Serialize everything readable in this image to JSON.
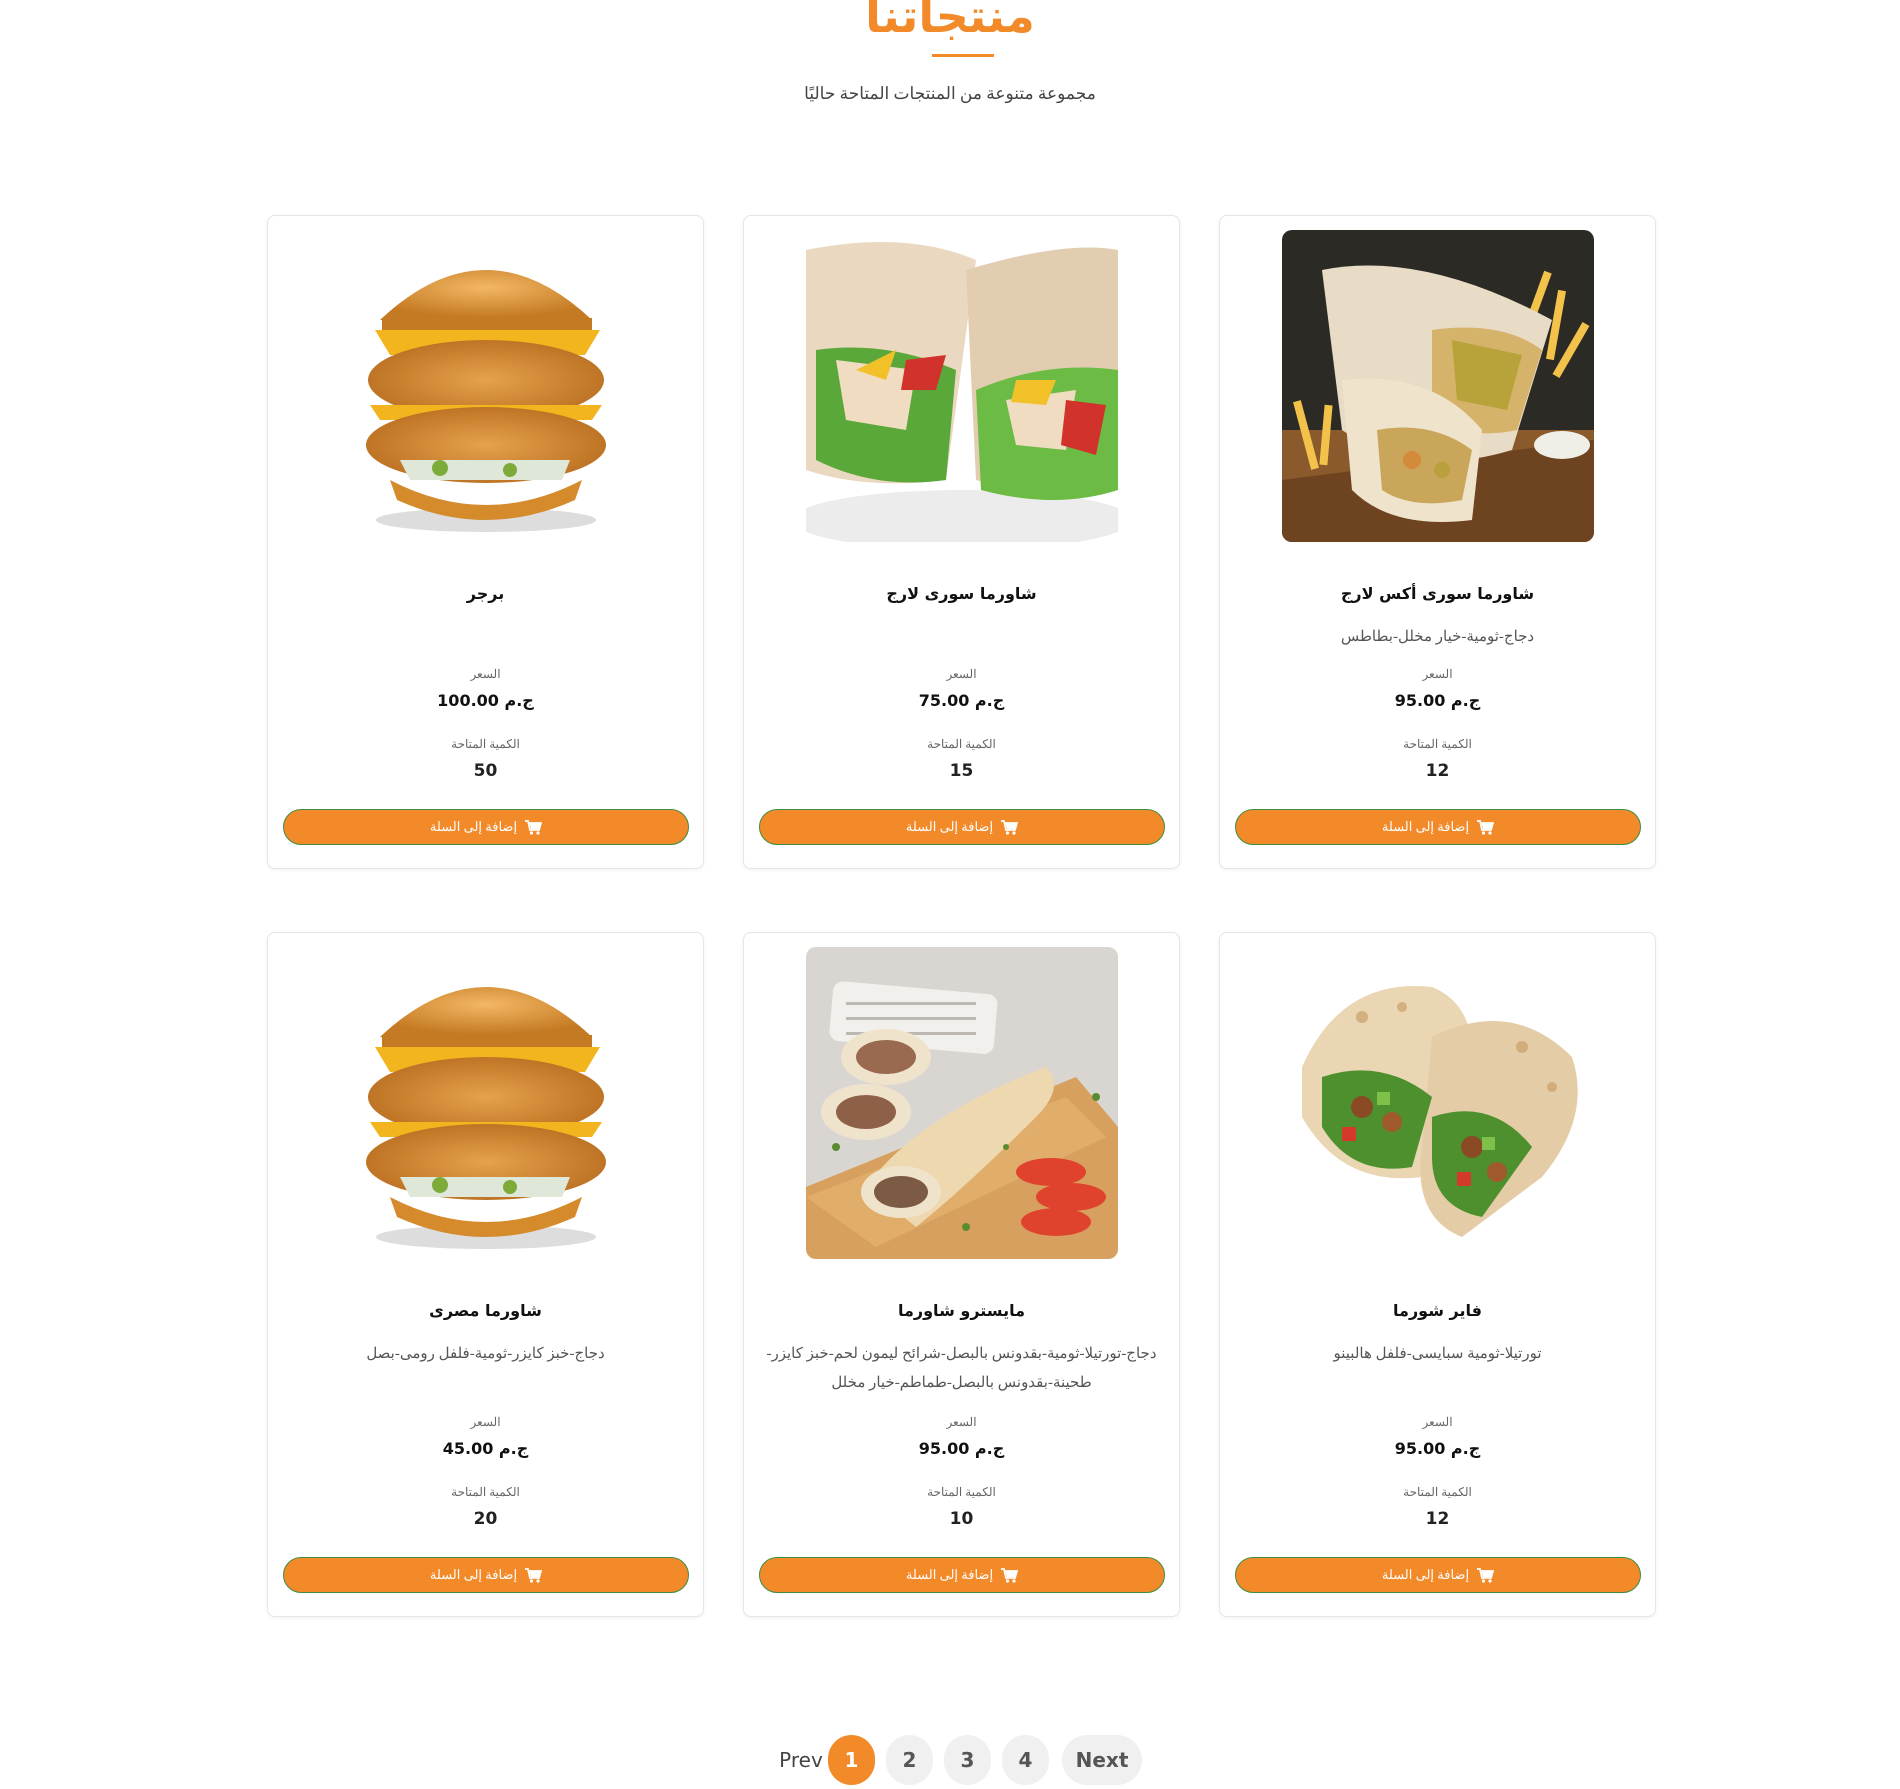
{
  "header": {
    "title": "منتجاتنا",
    "subtitle": "مجموعة متنوعة من المنتجات المتاحة حاليًا"
  },
  "labels": {
    "price": "السعر",
    "quantity": "الكمية المتاحة",
    "add_to_cart": "إضافة إلى السلة"
  },
  "products": [
    {
      "name": "شاورما سورى أكس لارج",
      "description": "دجاج-ثومية-خيار مخلل-بطاطس",
      "price": "ج.م 95.00",
      "quantity": "12",
      "image_icon": "shawarma-fries-photo"
    },
    {
      "name": "شاورما سورى لارج",
      "description": "",
      "price": "ج.م 75.00",
      "quantity": "15",
      "image_icon": "chicken-wrap-photo"
    },
    {
      "name": "برجر",
      "description": "",
      "price": "ج.م 100.00",
      "quantity": "50",
      "image_icon": "chicken-burger-photo"
    },
    {
      "name": "فاير شورما",
      "description": "تورتيلا-ثومية سبايسى-فلفل هالبينو",
      "price": "ج.م 95.00",
      "quantity": "12",
      "image_icon": "fire-wrap-photo"
    },
    {
      "name": "مايسترو شاورما",
      "description": "دجاج-تورتيلا-ثومية-بقدونس بالبصل-شرائح ليمون لحم-خبز كايزر-طحينة-بقدونس بالبصل-طماطم-خيار مخلل",
      "price": "ج.م 95.00",
      "quantity": "10",
      "image_icon": "maestro-shawarma-photo"
    },
    {
      "name": "شاورما مصرى",
      "description": "دجاج-خبز كايزر-ثومية-فلفل رومى-بصل",
      "price": "ج.م 45.00",
      "quantity": "20",
      "image_icon": "chicken-burger-photo"
    }
  ],
  "pagination": {
    "prev": "Prev",
    "pages": [
      "1",
      "2",
      "3",
      "4"
    ],
    "active_page": "1",
    "next": "Next"
  },
  "colors": {
    "accent": "#f28a2a",
    "button_border": "#3e8e41"
  }
}
